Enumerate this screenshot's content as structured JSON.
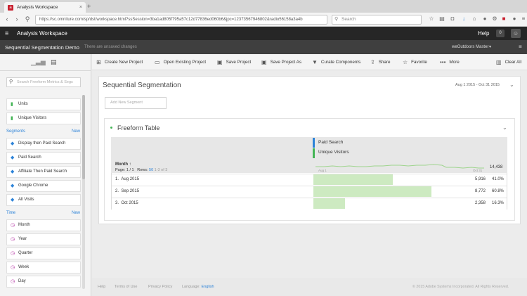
{
  "browser": {
    "tab_title": "Analysis Workspace",
    "tab_close": "×",
    "new_tab": "+",
    "url": "https://sc.omniture.com/sp/dst/workspace.html?ssSession=3ba1ad805f795a57c12d77836ed060b6&jpc=12373567946802&radio56158a3a4b",
    "search_placeholder": "Search"
  },
  "app": {
    "name": "Analysis Workspace",
    "help": "Help",
    "notifications": "0"
  },
  "project": {
    "name": "Sequential Segmentation Demo",
    "status": "There are unsaved changes",
    "report_suite": "weOutdoors Master"
  },
  "rail": {
    "search_placeholder": "Search Freeform Metrics & Segs",
    "metrics": [
      "Units",
      "Unique Visitors"
    ],
    "segments_header": "Segments",
    "segments_new": "New",
    "segments": [
      "Display then Paid Search",
      "Paid Search",
      "Affiliate Then Paid Search",
      "Google Chrome",
      "All Visits"
    ],
    "time_header": "Time",
    "time_new": "New",
    "time": [
      "Month",
      "Year",
      "Quarter",
      "Week",
      "Day"
    ]
  },
  "toolbar": {
    "create": "Create New Project",
    "open": "Open Existing Project",
    "save": "Save Project",
    "save_as": "Save Project As",
    "curate": "Curate Components",
    "share": "Share",
    "favorite": "Favorite",
    "more": "More",
    "clear": "Clear All"
  },
  "panel": {
    "title": "Sequential Segmentation",
    "date_range": "Aug 1 2015 - Oct 31 2015",
    "add_segment": "Add New Segment"
  },
  "freeform": {
    "title": "Freeform Table",
    "segment": "Paid Search",
    "metric": "Unique Visitors",
    "dimension": "Month",
    "page_label": "Page:",
    "page_value": "1 / 1",
    "rows_label": "Rows:",
    "rows_value": "50",
    "rows_range": "1-3 of 3",
    "spark_start": "Aug 1",
    "spark_end": "Oct 31",
    "total": "14,438",
    "rows": [
      {
        "index": "1.",
        "label": "Aug 2015",
        "value": "5,916",
        "pct": "41.0%",
        "share": 0.41
      },
      {
        "index": "2.",
        "label": "Sep 2015",
        "value": "8,772",
        "pct": "60.8%",
        "share": 0.608
      },
      {
        "index": "3.",
        "label": "Oct 2015",
        "value": "2,358",
        "pct": "16.3%",
        "share": 0.163
      }
    ]
  },
  "footer": {
    "help": "Help",
    "terms": "Terms of Use",
    "privacy": "Privacy Policy",
    "language_label": "Language:",
    "language": "English",
    "copyright": "© 2015 Adobe Systems Incorporated. All Rights Reserved."
  },
  "colors": {
    "segment": "#2d83d8",
    "metric": "#44b556",
    "dimension": "#b83fa8",
    "bar": "#cdeac1"
  }
}
